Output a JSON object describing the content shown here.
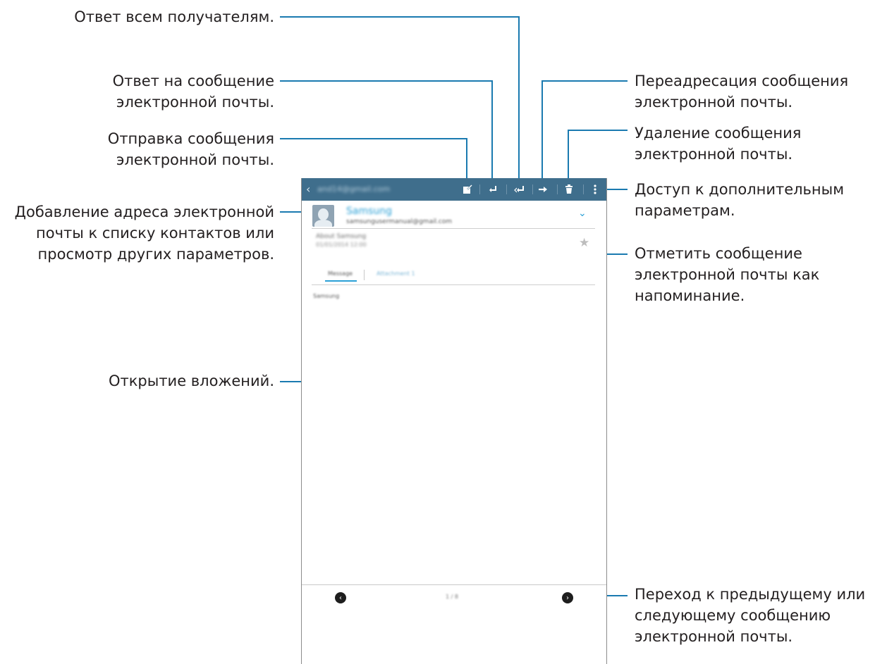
{
  "callouts": {
    "reply_all": "Ответ всем получателям.",
    "reply": "Ответ на сообщение\nэлектронной почты.",
    "compose": "Отправка сообщения\nэлектронной почты.",
    "add_contact": "Добавление адреса электронной\nпочты к списку контактов или\nпросмотр других параметров.",
    "attachments": "Открытие вложений.",
    "forward": "Переадресация сообщения\nэлектронной почты.",
    "delete": "Удаление сообщения\nэлектронной почты.",
    "more": "Доступ к дополнительным\nпараметрам.",
    "mark": "Отметить сообщение\nэлектронной почты как\nнапоминание.",
    "navigate": "Переход к предыдущему или\nследующему сообщению\nэлектронной почты."
  },
  "email": {
    "account": "and14@gmail.com",
    "sender_name": "Samsung",
    "sender_email": "samsungusermanual@gmail.com",
    "subject": "About Samsung",
    "date": "01/01/2014 12:00",
    "tab_message": "Message",
    "tab_attachments": "Attachment 1",
    "body": "Samsung",
    "page_indicator": "1 / 8"
  },
  "icons": {
    "back": "back-icon",
    "compose": "compose-icon",
    "reply": "reply-icon",
    "reply_all": "reply-all-icon",
    "forward": "forward-icon",
    "delete": "trash-icon",
    "more": "more-vert-icon",
    "expand": "chevron-down-icon",
    "star": "star-icon",
    "prev": "prev-arrow-icon",
    "next": "next-arrow-icon"
  },
  "colors": {
    "callout_line": "#1a7ab0",
    "action_bar": "#3f6e8c",
    "accent": "#2aa0d6"
  }
}
